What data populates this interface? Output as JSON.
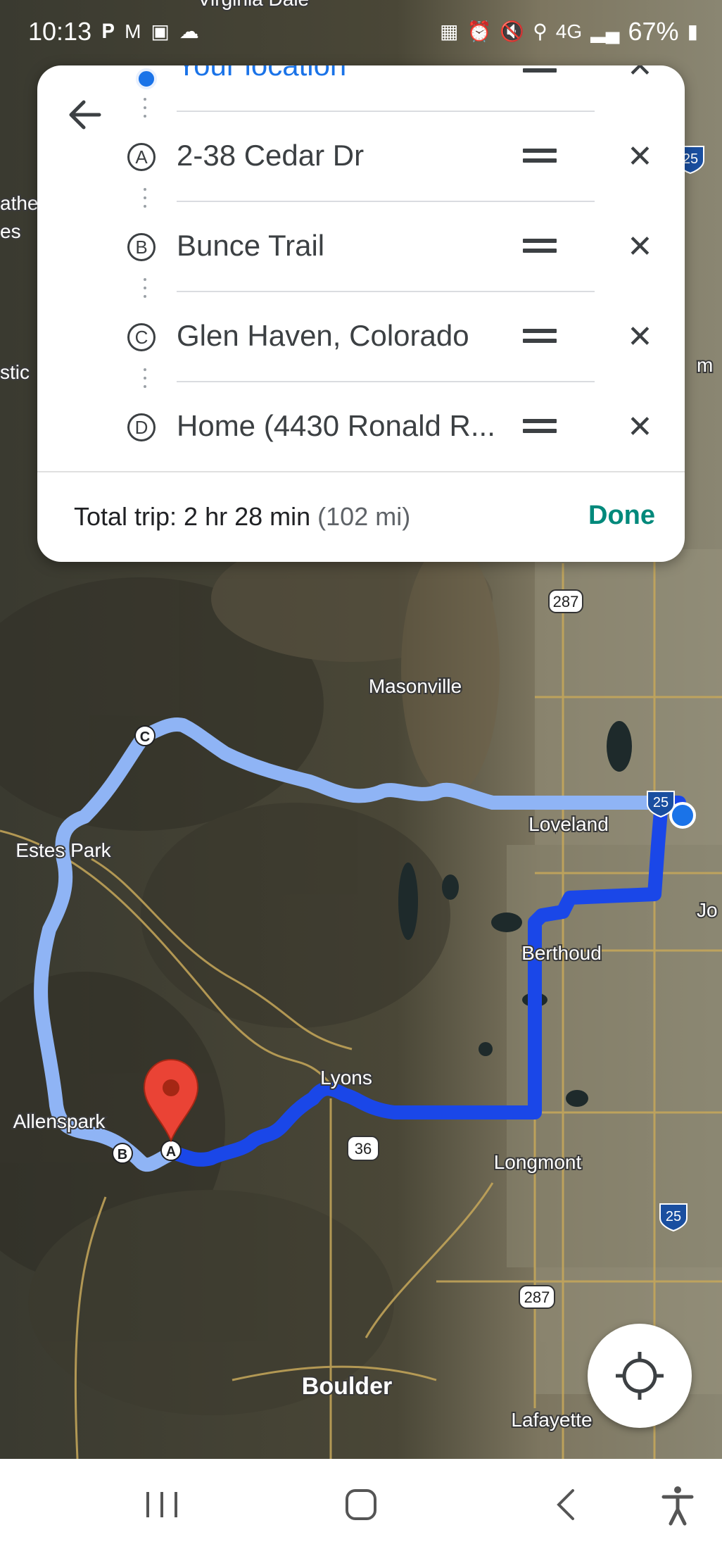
{
  "status_bar": {
    "time": "10:13",
    "battery": "67%",
    "network": "4G",
    "left_icons": [
      "paypal-icon",
      "gmail-icon",
      "gallery-icon",
      "cloud-icon"
    ],
    "right_icons": [
      "nfc-icon",
      "alarm-icon",
      "mute-icon",
      "location-icon",
      "signal-icon",
      "battery-icon"
    ]
  },
  "panel": {
    "stops": [
      {
        "letter": "",
        "name": "Your location"
      },
      {
        "letter": "A",
        "name": "2-38 Cedar Dr"
      },
      {
        "letter": "B",
        "name": "Bunce Trail"
      },
      {
        "letter": "C",
        "name": "Glen Haven, Colorado"
      },
      {
        "letter": "D",
        "name": "Home (4430 Ronald R..."
      }
    ],
    "trip_label": "Total trip: 2 hr 28 min",
    "trip_distance": "(102 mi)",
    "done_label": "Done"
  },
  "map": {
    "places": [
      "Virginia Dale",
      "Masonville",
      "Loveland",
      "Estes Park",
      "Berthoud",
      "Lyons",
      "Allenspark",
      "Longmont",
      "Boulder",
      "Lafayette"
    ],
    "edge_labels": [
      "athe",
      "es",
      "stic",
      "m",
      "Jo"
    ],
    "shields": [
      "25",
      "287",
      "25",
      "36",
      "25",
      "287"
    ],
    "markers": [
      "A",
      "B",
      "C"
    ],
    "route_colors": {
      "primary": "#1a47e8",
      "alternate": "#8fb4f5"
    }
  },
  "nav_bar": {
    "buttons": [
      "recent-apps",
      "home",
      "back",
      "accessibility"
    ]
  }
}
